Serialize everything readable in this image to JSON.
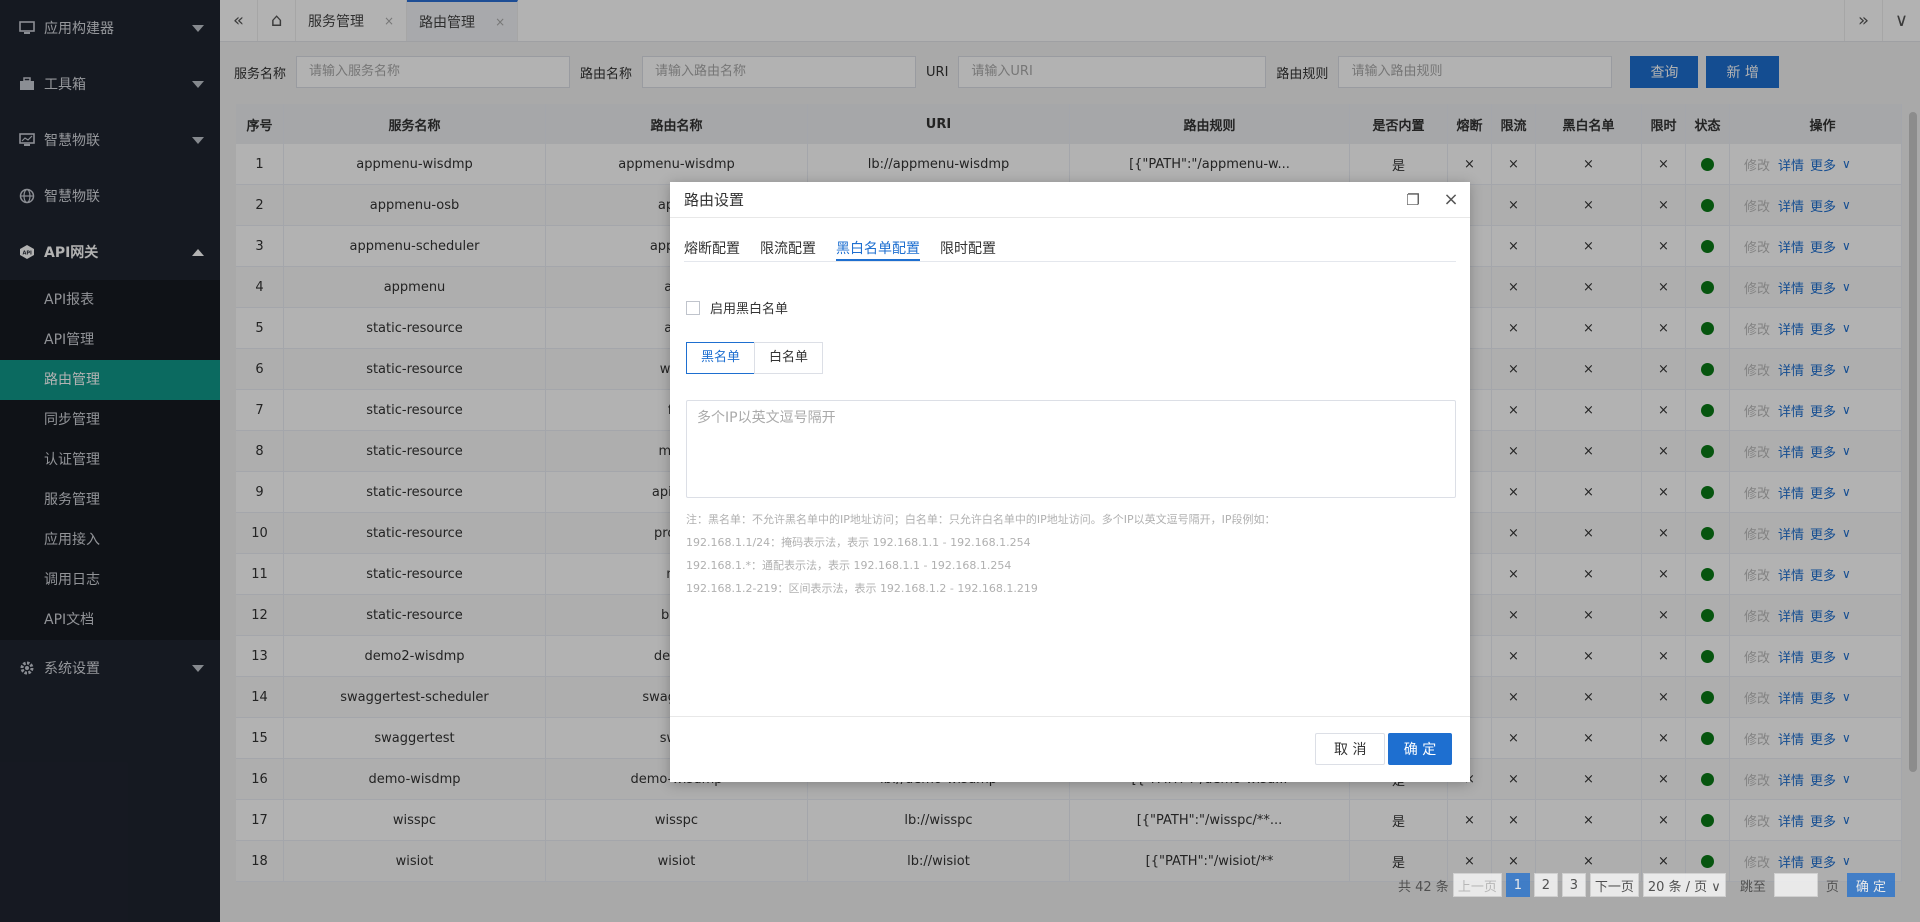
{
  "sidebar": {
    "menus": [
      {
        "label": "应用构建器",
        "icon": "monitor-icon"
      },
      {
        "label": "工具箱",
        "icon": "toolbox-icon"
      },
      {
        "label": "智慧物联",
        "icon": "monitor-chart-icon"
      },
      {
        "label": "智慧物联",
        "icon": "globe-icon"
      },
      {
        "label": "API网关",
        "icon": "api-icon"
      },
      {
        "label": "系统设置",
        "icon": "gear-icon"
      }
    ],
    "sub": [
      "API报表",
      "API管理",
      "路由管理",
      "同步管理",
      "认证管理",
      "服务管理",
      "应用接入",
      "调用日志",
      "API文档"
    ]
  },
  "topbar": {
    "collapse": "«",
    "home": "⌂",
    "tabs": [
      {
        "label": "服务管理"
      },
      {
        "label": "路由管理"
      }
    ],
    "close": "×",
    "expand": "»",
    "more": "∨"
  },
  "filters": {
    "service_label": "服务名称",
    "service_ph": "请输入服务名称",
    "route_label": "路由名称",
    "route_ph": "请输入路由名称",
    "uri_label": "URI",
    "uri_ph": "请输入URI",
    "rule_label": "路由规则",
    "rule_ph": "请输入路由规则",
    "search": "查询",
    "add": "新 增"
  },
  "table": {
    "headers": [
      "序号",
      "服务名称",
      "路由名称",
      "URI",
      "路由规则",
      "是否内置",
      "熔断",
      "限流",
      "黑白名单",
      "限时",
      "状态",
      "操作"
    ],
    "ops": {
      "edit": "修改",
      "detail": "详情",
      "more": "更多",
      "chev": "∨"
    },
    "rows": [
      [
        "1",
        "appmenu-wisdmp",
        "appmenu-wisdmp",
        "lb://appmenu-wisdmp",
        "[{\"PATH\":\"/appmenu-w...",
        "是",
        "×",
        "×",
        "×",
        "×"
      ],
      [
        "2",
        "appmenu-osb",
        "appm",
        "",
        "",
        "",
        "",
        "×",
        "×",
        "×"
      ],
      [
        "3",
        "appmenu-scheduler",
        "appmen",
        "",
        "",
        "",
        "",
        "×",
        "×",
        "×"
      ],
      [
        "4",
        "appmenu",
        "app",
        "",
        "",
        "",
        "",
        "×",
        "×",
        "×"
      ],
      [
        "5",
        "static-resource",
        "app",
        "",
        "",
        "",
        "",
        "×",
        "×",
        "×"
      ],
      [
        "6",
        "static-resource",
        "wisfo",
        "",
        "",
        "",
        "",
        "×",
        "×",
        "×"
      ],
      [
        "7",
        "static-resource",
        "fro",
        "",
        "",
        "",
        "",
        "×",
        "×",
        "×"
      ],
      [
        "8",
        "static-resource",
        "mcap",
        "",
        "",
        "",
        "",
        "×",
        "×",
        "×"
      ],
      [
        "9",
        "static-resource",
        "apigate",
        "",
        "",
        "",
        "",
        "×",
        "×",
        "×"
      ],
      [
        "10",
        "static-resource",
        "produc",
        "",
        "",
        "",
        "",
        "×",
        "×",
        "×"
      ],
      [
        "11",
        "static-resource",
        "mo",
        "",
        "",
        "",
        "",
        "×",
        "×",
        "×"
      ],
      [
        "12",
        "static-resource",
        "back",
        "",
        "",
        "",
        "",
        "×",
        "×",
        "×"
      ],
      [
        "13",
        "demo2-wisdmp",
        "demo2",
        "",
        "",
        "",
        "",
        "×",
        "×",
        "×"
      ],
      [
        "14",
        "swaggertest-scheduler",
        "swaggerte",
        "",
        "",
        "",
        "",
        "×",
        "×",
        "×"
      ],
      [
        "15",
        "swaggertest",
        "swag",
        "",
        "",
        "",
        "",
        "×",
        "×",
        "×"
      ],
      [
        "16",
        "demo-wisdmp",
        "demo-wisdmp",
        "lb://demo-wisdmp",
        "[{\"PATH\":\"/demo-wisd...",
        "是",
        "×",
        "×",
        "×",
        "×"
      ],
      [
        "17",
        "wisspc",
        "wisspc",
        "lb://wisspc",
        "[{\"PATH\":\"/wisspc/**...",
        "是",
        "×",
        "×",
        "×",
        "×"
      ],
      [
        "18",
        "wisiot",
        "wisiot",
        "lb://wisiot",
        "[{\"PATH\":\"/wisiot/**",
        "是",
        "×",
        "×",
        "×",
        "×"
      ]
    ]
  },
  "pager": {
    "total": "共 42 条",
    "prev": "上一页",
    "p1": "1",
    "p2": "2",
    "p3": "3",
    "next": "下一页",
    "size": "20 条 / 页 ∨",
    "jump": "跳至",
    "page": "页",
    "ok": "确 定"
  },
  "modal": {
    "title": "路由设置",
    "restore": "❐",
    "close": "×",
    "tabs": [
      "熔断配置",
      "限流配置",
      "黑白名单配置",
      "限时配置"
    ],
    "enable": "启用黑白名单",
    "seg": [
      "黑名单",
      "白名单"
    ],
    "textarea_ph": "多个IP以英文逗号隔开",
    "notes": [
      "注：黑名单：不允许黑名单中的IP地址访问；白名单：只允许白名单中的IP地址访问。多个IP以英文逗号隔开，IP段例如：",
      "192.168.1.1/24：掩码表示法，表示 192.168.1.1 - 192.168.1.254",
      "192.168.1.*：通配表示法，表示 192.168.1.1 - 192.168.1.254",
      "192.168.1.2-219：区间表示法，表示 192.168.1.2 - 192.168.1.219"
    ],
    "cancel": "取 消",
    "ok": "确 定"
  }
}
